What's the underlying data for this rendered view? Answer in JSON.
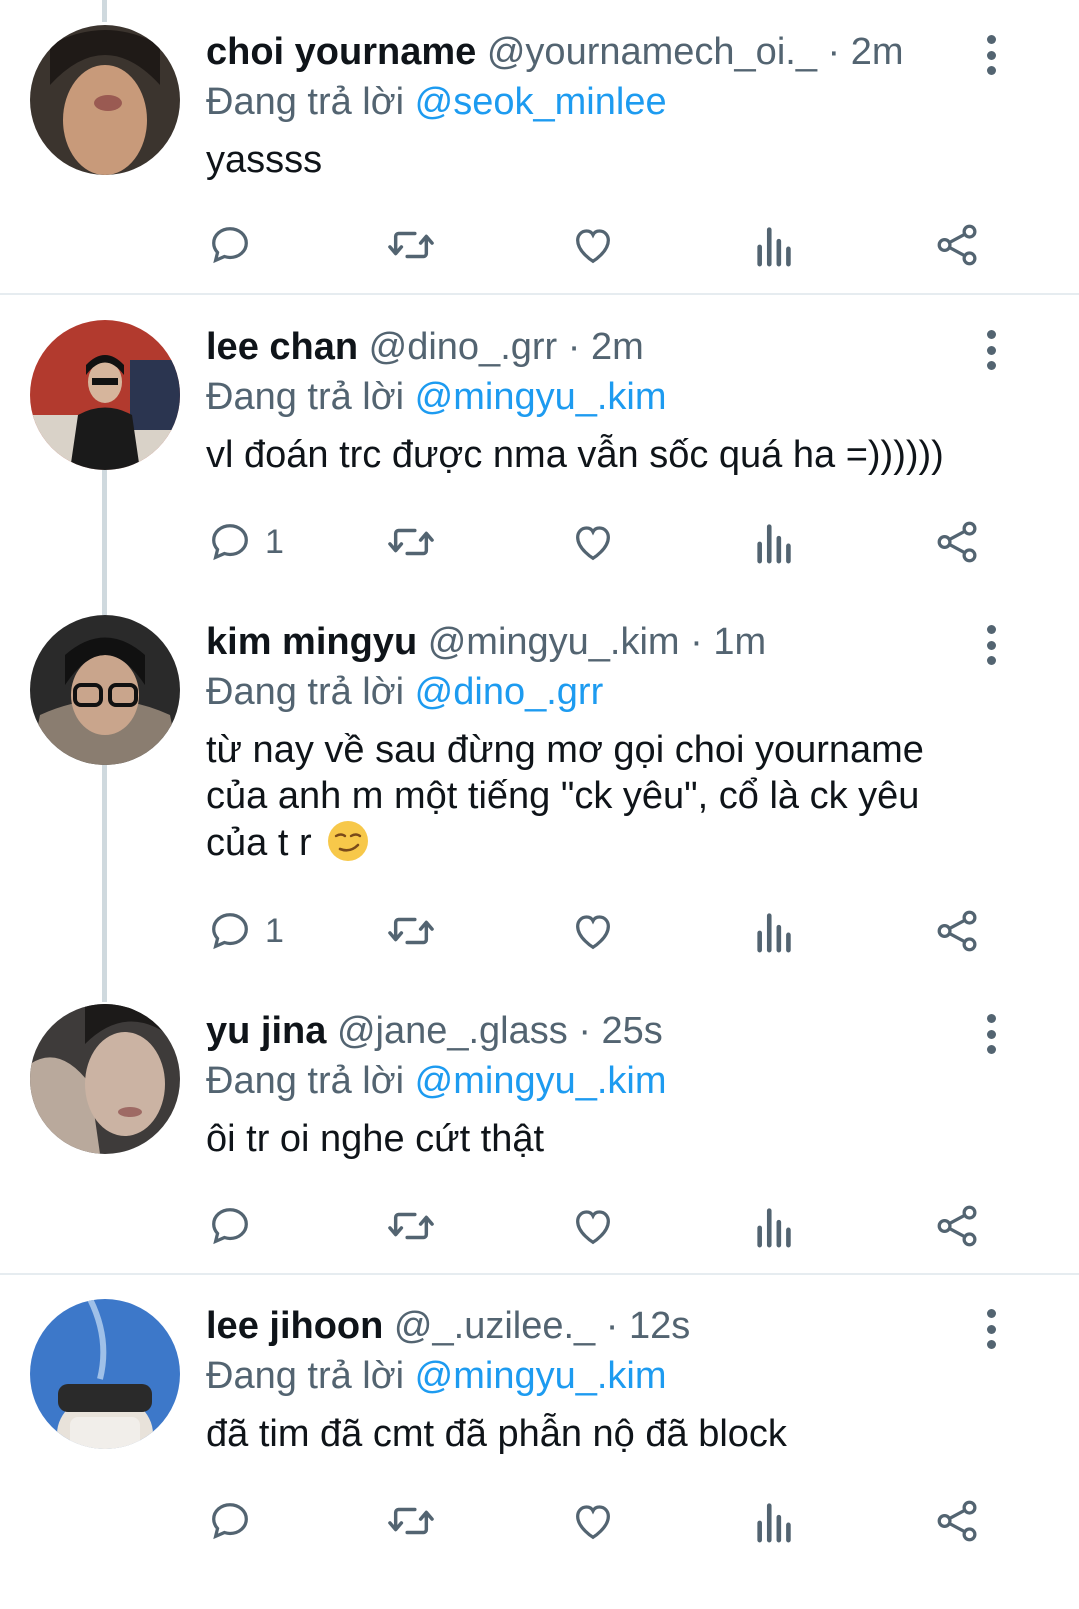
{
  "reply_prefix": "Đang trả lời",
  "tweets": [
    {
      "name": "choi yourname",
      "handle": "@yournamech_oi._",
      "time": "· 2m",
      "reply_to": "@seok_minlee",
      "text": "yassss",
      "counts": {
        "reply": ""
      },
      "avatar_colors": [
        "#3b342e",
        "#c89a7a"
      ]
    },
    {
      "name": "lee chan",
      "handle": "@dino_.grr",
      "time": "· 2m",
      "reply_to": "@mingyu_.kim",
      "text": "vl đoán trc được nma vẫn sốc quá ha =))))))",
      "counts": {
        "reply": "1"
      },
      "avatar_colors": [
        "#b23a2e",
        "#1a1a1a"
      ]
    },
    {
      "name": "kim mingyu",
      "handle": "@mingyu_.kim",
      "time": "· 1m",
      "reply_to": "@dino_.grr",
      "text_lines": [
        "từ nay về sau đừng mơ gọi choi yourname",
        "của anh m một tiếng \"ck yêu\", cổ là ck yêu",
        "của t r"
      ],
      "counts": {
        "reply": "1"
      },
      "avatar_colors": [
        "#2a2a2a",
        "#8a7d70"
      ]
    },
    {
      "name": "yu jina",
      "handle": "@jane_.glass",
      "time": "· 25s",
      "reply_to": "@mingyu_.kim",
      "text": "ôi tr oi nghe cứt thật",
      "counts": {
        "reply": ""
      },
      "avatar_colors": [
        "#3e3b3a",
        "#b9a99c"
      ]
    },
    {
      "name": "lee jihoon",
      "handle": "@_.uzilee._",
      "time": "· 12s",
      "reply_to": "@mingyu_.kim",
      "text": "đã tim đã cmt đã phẫn nộ đã block",
      "counts": {
        "reply": ""
      },
      "avatar_colors": [
        "#3d78c9",
        "#e8e2da"
      ]
    }
  ],
  "colors": {
    "accent": "#1d9bf0",
    "secondary_text": "#536471",
    "primary_text": "#0f1419",
    "icon": "#536471"
  },
  "icons": [
    "reply-icon",
    "retweet-icon",
    "like-icon",
    "views-icon",
    "share-icon",
    "more-icon"
  ]
}
